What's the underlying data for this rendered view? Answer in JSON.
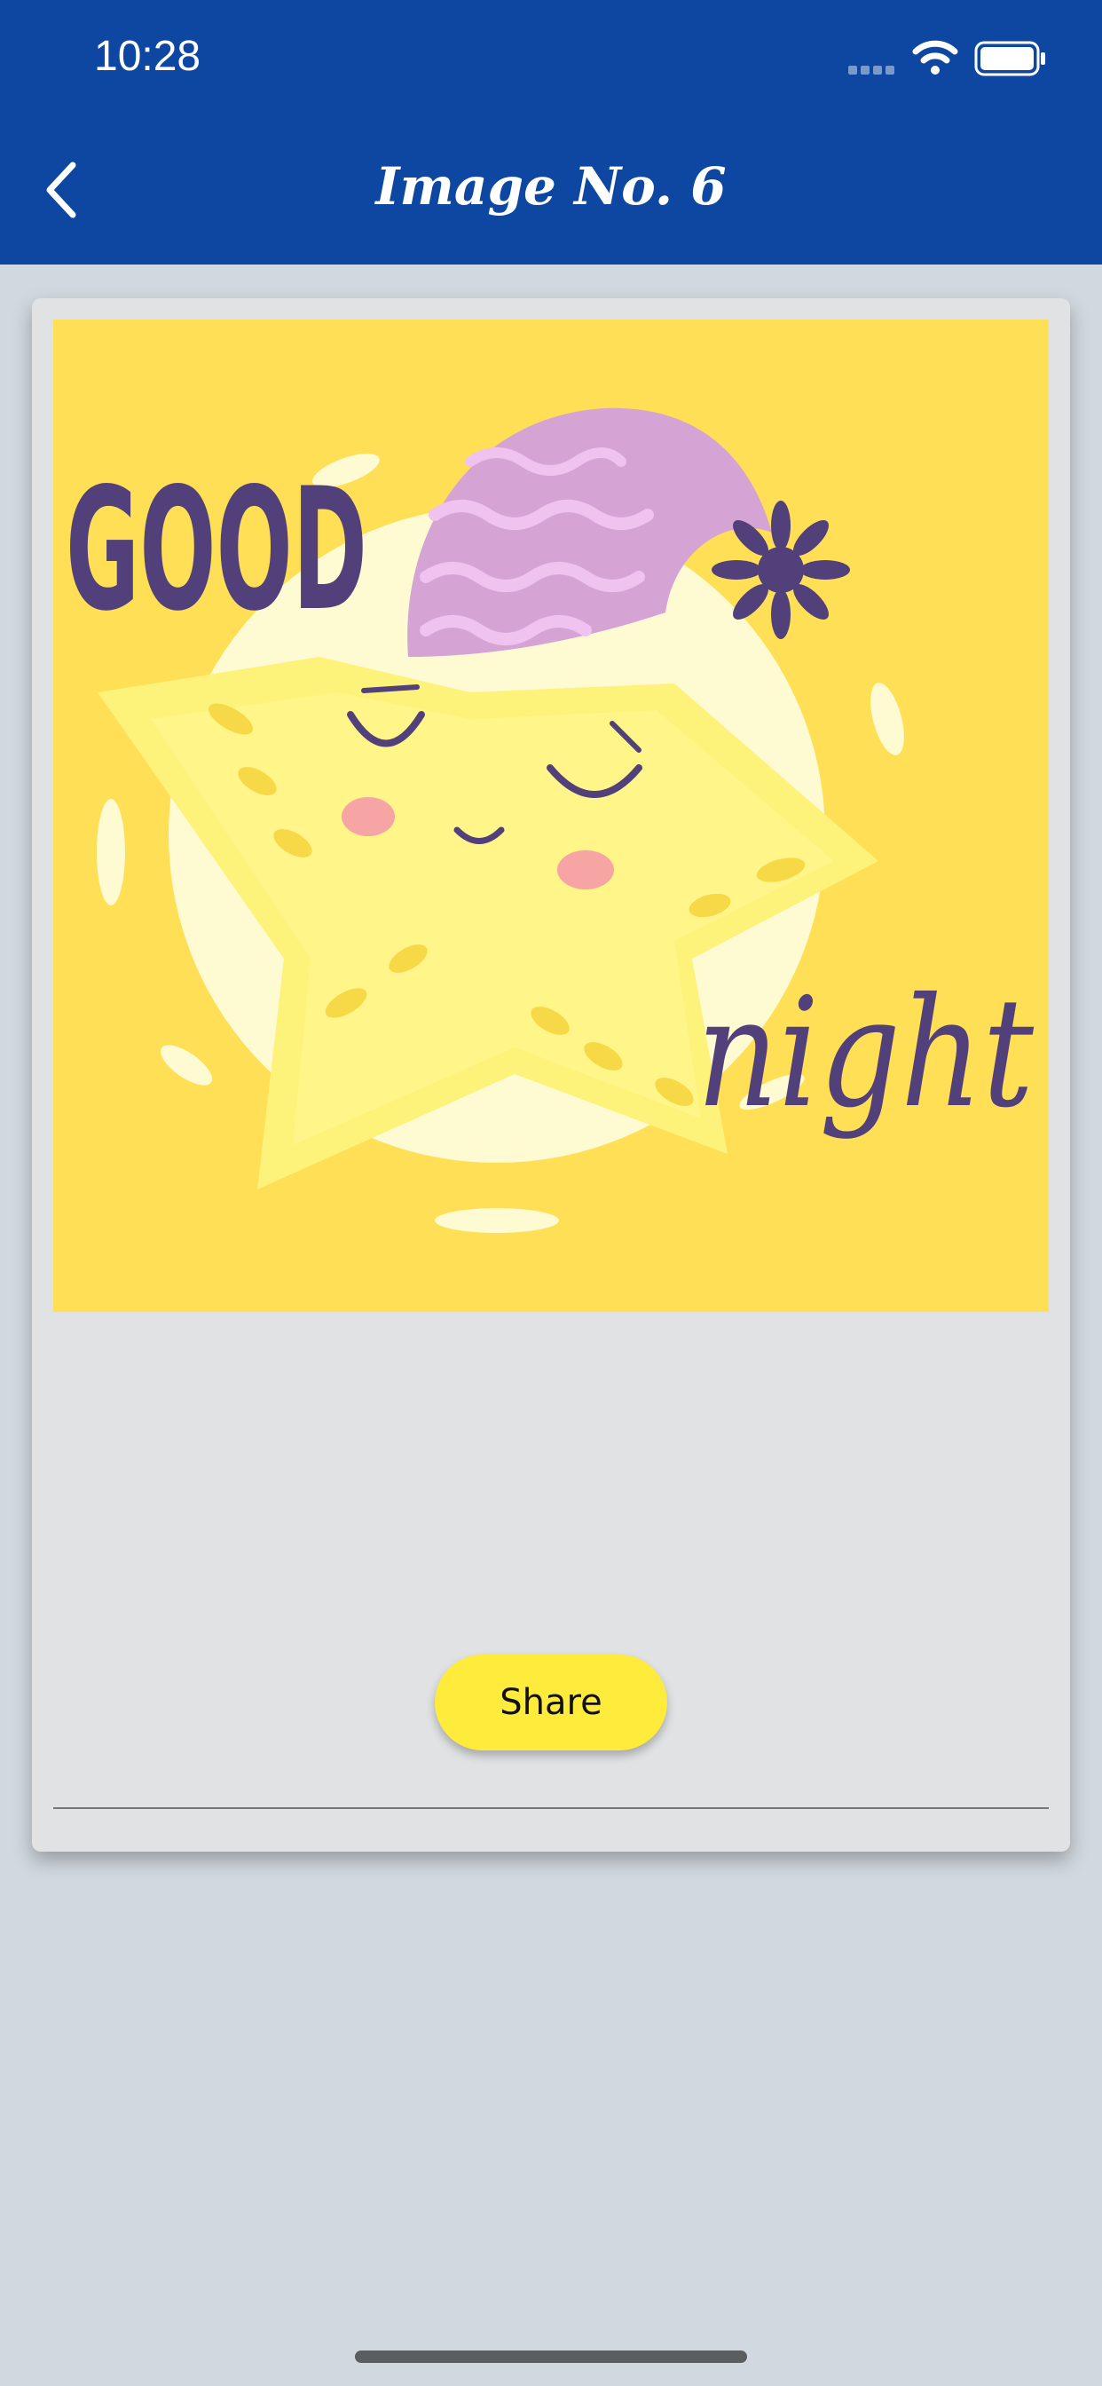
{
  "status_bar": {
    "time": "10:28"
  },
  "header": {
    "title": "Image No. 6",
    "back_icon": "chevron-left-icon"
  },
  "card": {
    "image": {
      "alt_subject": "sleeping star with nightcap",
      "text_top": "GOOD",
      "text_bottom": "night"
    },
    "share_label": "Share"
  },
  "colors": {
    "header_bg": "#0e47a1",
    "page_bg": "#d1d8df",
    "card_bg": "#e0e2e3",
    "image_bg": "#fedf55",
    "share_bg": "#ffeb3b"
  }
}
